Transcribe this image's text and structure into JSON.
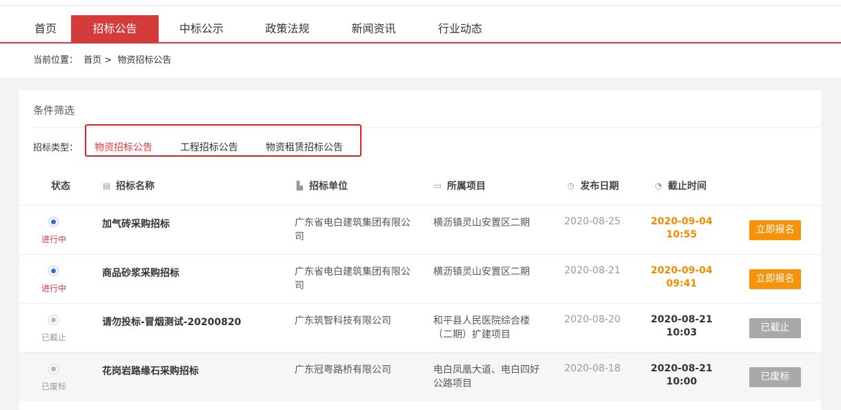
{
  "nav": {
    "items": [
      {
        "label": "首页"
      },
      {
        "label": "招标公告"
      },
      {
        "label": "中标公示"
      },
      {
        "label": "政策法规"
      },
      {
        "label": "新闻资讯"
      },
      {
        "label": "行业动态"
      }
    ],
    "active_index": 1
  },
  "breadcrumb": {
    "prefix": "当前位置：",
    "home": "首页 >",
    "current": "物资招标公告"
  },
  "filter": {
    "title": "条件筛选",
    "type_label": "招标类型：",
    "types": [
      "物资招标公告",
      "工程招标公告",
      "物资租赁招标公告"
    ],
    "active_type": 0
  },
  "table": {
    "headers": {
      "status": "状态",
      "name": "招标名称",
      "unit": "招标单位",
      "project": "所属项目",
      "publish": "发布日期",
      "deadline": "截止时间"
    },
    "rows": [
      {
        "status": "进行中",
        "name": "加气砖采购招标",
        "unit": "广东省电白建筑集团有限公司",
        "project": "横沥镇灵山安置区二期",
        "publish": "2020-08-25",
        "deadline_date": "2020-09-04",
        "deadline_time": "10:55",
        "action": "立即报名"
      },
      {
        "status": "进行中",
        "name": "商品砂浆采购招标",
        "unit": "广东省电白建筑集团有限公司",
        "project": "横沥镇灵山安置区二期",
        "publish": "2020-08-21",
        "deadline_date": "2020-09-04",
        "deadline_time": "09:41",
        "action": "立即报名"
      },
      {
        "status": "已截止",
        "name": "请勿投标-冒烟测试-20200820",
        "unit": "广东筑智科技有限公司",
        "project": "和平县人民医院综合楼（二期）扩建项目",
        "publish": "2020-08-20",
        "deadline_date": "2020-08-21",
        "deadline_time": "10:03",
        "action": "已截止"
      },
      {
        "status": "已废标",
        "name": "花岗岩路缘石采购招标",
        "unit": "广东冠粤路桥有限公司",
        "project": "电白凤凰大道、电白四好公路项目",
        "publish": "2020-08-18",
        "deadline_date": "2020-08-21",
        "deadline_time": "10:00",
        "action": "已废标"
      }
    ]
  },
  "colors": {
    "brand_red": "#d63b3b",
    "highlight_box": "#e02020",
    "deadline_orange": "#f08c00",
    "button_orange": "#f5930b",
    "button_gray": "#a9a9a9",
    "radio_blue": "#2a6ee0"
  },
  "icons": {
    "name": "document-icon",
    "unit": "building-icon",
    "project": "folder-icon",
    "publish": "stopwatch-icon",
    "deadline": "clock-icon"
  }
}
